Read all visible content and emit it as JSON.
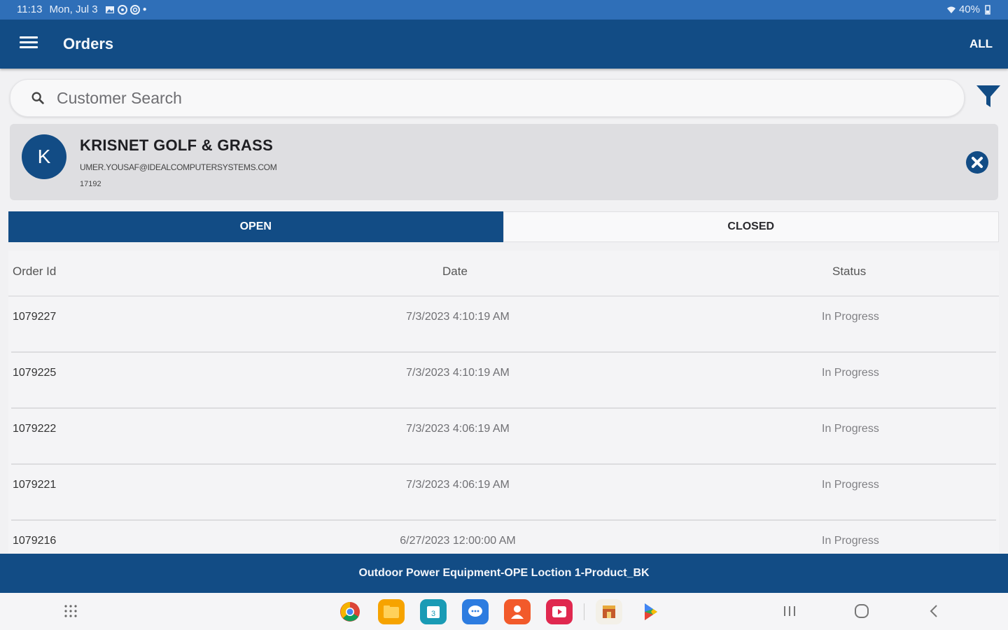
{
  "status_bar": {
    "time": "11:13",
    "date": "Mon, Jul 3",
    "battery": "40%"
  },
  "app_bar": {
    "title": "Orders",
    "all_label": "ALL"
  },
  "search": {
    "placeholder": "Customer Search"
  },
  "customer": {
    "initial": "K",
    "name": "KRISNET GOLF & GRASS",
    "email": "UMER.YOUSAF@IDEALCOMPUTERSYSTEMS.COM",
    "id": "17192"
  },
  "tabs": [
    {
      "label": "OPEN",
      "active": true
    },
    {
      "label": "CLOSED",
      "active": false
    }
  ],
  "table": {
    "headers": {
      "order_id": "Order Id",
      "date": "Date",
      "status": "Status"
    },
    "rows": [
      {
        "order_id": "1079227",
        "date": "7/3/2023 4:10:19 AM",
        "status": "In Progress"
      },
      {
        "order_id": "1079225",
        "date": "7/3/2023 4:10:19 AM",
        "status": "In Progress"
      },
      {
        "order_id": "1079222",
        "date": "7/3/2023 4:06:19 AM",
        "status": "In Progress"
      },
      {
        "order_id": "1079221",
        "date": "7/3/2023 4:06:19 AM",
        "status": "In Progress"
      },
      {
        "order_id": "1079216",
        "date": "6/27/2023 12:00:00 AM",
        "status": "In Progress"
      }
    ]
  },
  "footer": {
    "location": "Outdoor Power Equipment-OPE Loction 1-Product_BK"
  },
  "colors": {
    "primary": "#124c85",
    "status_bar": "#2f6fb8"
  },
  "dock_icons": [
    "chrome-icon",
    "files-icon",
    "calendar-icon",
    "messages-icon",
    "contacts-icon",
    "video-icon",
    "store-icon",
    "play-store-icon"
  ]
}
